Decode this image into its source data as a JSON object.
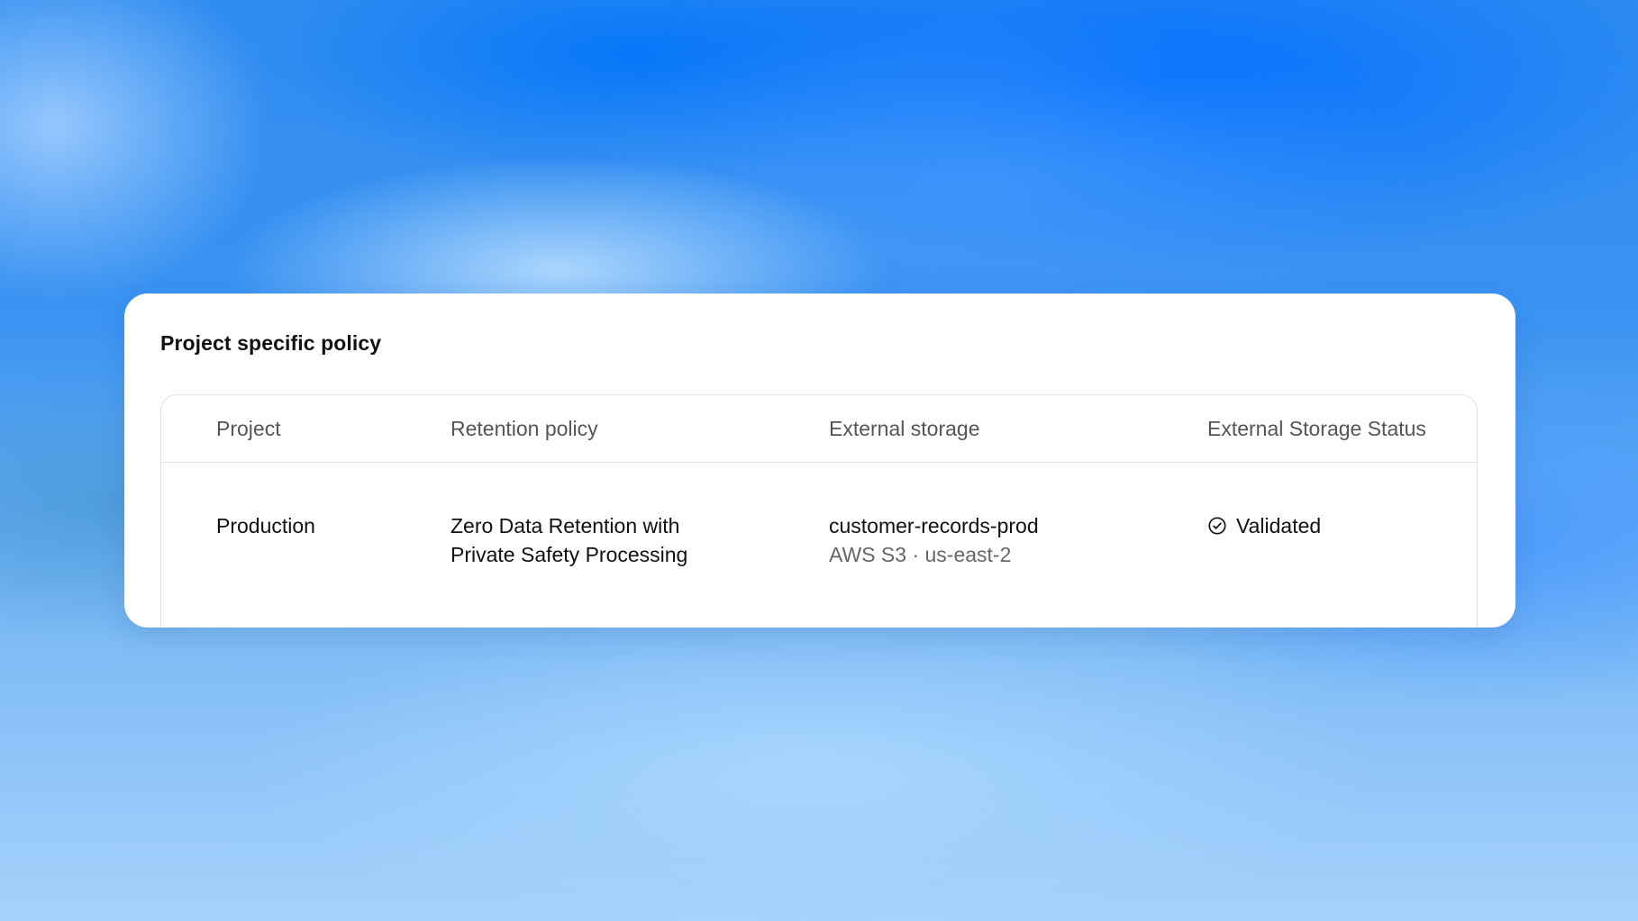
{
  "card": {
    "title": "Project specific policy"
  },
  "table": {
    "columns": [
      "Project",
      "Retention policy",
      "External storage",
      "External Storage Status"
    ],
    "rows": [
      {
        "project": "Production",
        "retention_policy_line1": "Zero Data Retention with",
        "retention_policy_line2": "Private Safety Processing",
        "storage_name": "customer-records-prod",
        "storage_location": "AWS S3 · us-east-2",
        "status": "Validated",
        "status_icon": "check-circle-icon",
        "status_color": "#4aa14e"
      }
    ]
  }
}
